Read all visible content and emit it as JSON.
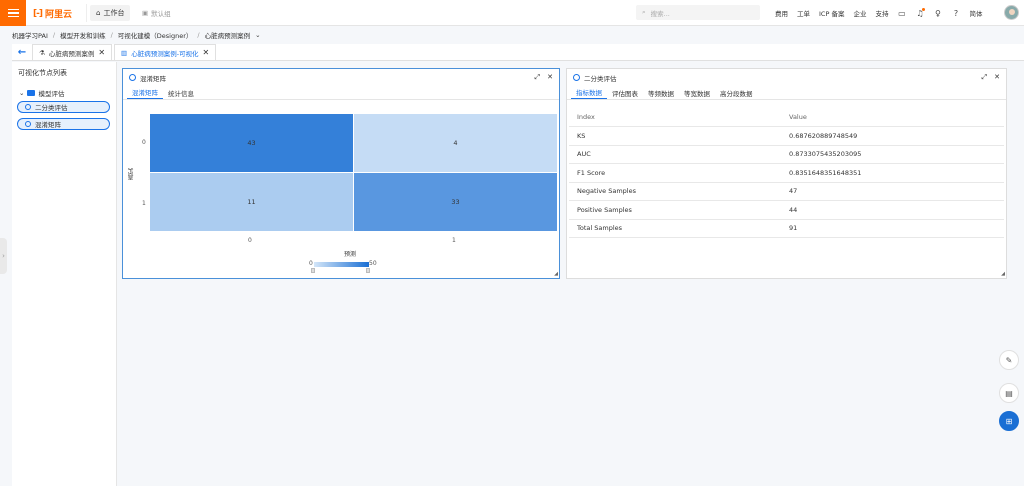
{
  "topbar": {
    "brand": "阿里云",
    "workbench": "工作台",
    "resource_group": "默认组",
    "search_placeholder": "搜索...",
    "links": [
      "费用",
      "工单",
      "ICP 备案",
      "企业",
      "支持"
    ],
    "language": "简体"
  },
  "breadcrumb": [
    "机器学习PAI",
    "模型开发和训练",
    "可视化建模（Designer）",
    "心脏病预测案例"
  ],
  "page_tabs": [
    {
      "label": "心脏病预测案例",
      "active": false
    },
    {
      "label": "心脏病预测案例-可视化",
      "active": true
    }
  ],
  "left_panel": {
    "title": "可视化节点列表",
    "folder": "模型评估",
    "nodes": [
      "二分类评估",
      "混淆矩阵"
    ]
  },
  "confusion_panel": {
    "title": "混淆矩阵",
    "tabs": [
      "混淆矩阵",
      "统计信息"
    ],
    "x_label": "预测",
    "y_label": "真实",
    "x_ticks": [
      "0",
      "1"
    ],
    "y_ticks": [
      "0",
      "1"
    ],
    "colorbar_min": "0",
    "colorbar_max": "50"
  },
  "chart_data": {
    "type": "heatmap",
    "xlabel": "预测",
    "ylabel": "真实",
    "x_categories": [
      "0",
      "1"
    ],
    "y_categories": [
      "0",
      "1"
    ],
    "values": [
      [
        43,
        4
      ],
      [
        11,
        33
      ]
    ],
    "color_range": [
      0,
      50
    ]
  },
  "eval_panel": {
    "title": "二分类评估",
    "tabs": [
      "指标数据",
      "评估图表",
      "等频数据",
      "等宽数据",
      "高分段数据"
    ],
    "columns": [
      "Index",
      "Value"
    ],
    "rows": [
      [
        "KS",
        "0.687620889748549"
      ],
      [
        "AUC",
        "0.8733075435203095"
      ],
      [
        "F1 Score",
        "0.8351648351648351"
      ],
      [
        "Negative Samples",
        "47"
      ],
      [
        "Positive Samples",
        "44"
      ],
      [
        "Total Samples",
        "91"
      ]
    ]
  },
  "colors": {
    "brand": "#ff6a00",
    "accent": "#1a73e8",
    "heat_high": "#1a6fd4",
    "heat_low": "#d4e6f8"
  }
}
